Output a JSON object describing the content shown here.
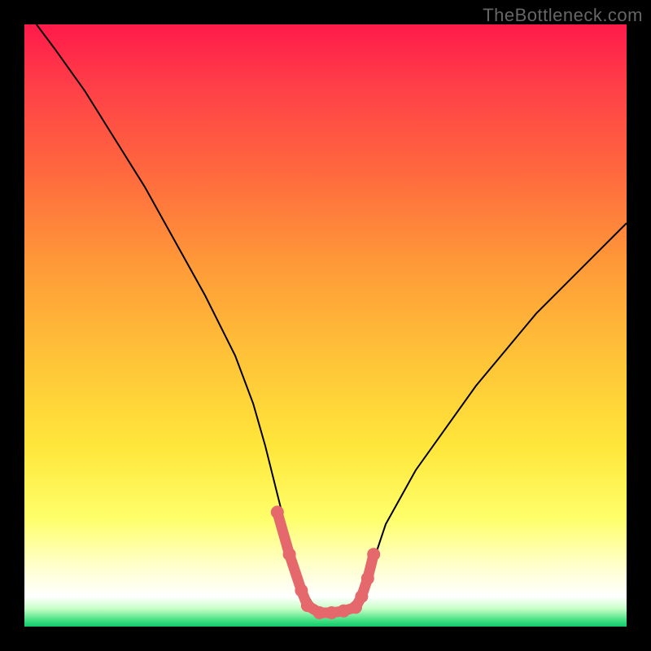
{
  "watermark": "TheBottleneck.com",
  "chart_data": {
    "type": "line",
    "title": "",
    "xlabel": "",
    "ylabel": "",
    "xlim": [
      0,
      100
    ],
    "ylim": [
      0,
      100
    ],
    "x": [
      2,
      5,
      10,
      15,
      20,
      25,
      30,
      35,
      38,
      40,
      42,
      44,
      46,
      48,
      50,
      52,
      54,
      56,
      58,
      60,
      65,
      70,
      75,
      80,
      85,
      90,
      95,
      100
    ],
    "y_curve": [
      100,
      96,
      89,
      81,
      73,
      64,
      55,
      45,
      37,
      30,
      22,
      14,
      7,
      3.5,
      2.3,
      2.3,
      3.2,
      6,
      11,
      17,
      26,
      33,
      40,
      46,
      52,
      57,
      62,
      67
    ],
    "trough_markers": {
      "x": [
        42,
        44,
        46,
        47,
        49,
        51,
        53,
        55,
        56,
        57,
        58
      ],
      "y": [
        19,
        12,
        6,
        3.5,
        2.3,
        2.3,
        2.6,
        3.2,
        5,
        8,
        12
      ]
    },
    "gradient_stops": [
      {
        "pos": 0.0,
        "color": "#ff1a4a"
      },
      {
        "pos": 0.25,
        "color": "#ff6a3e"
      },
      {
        "pos": 0.55,
        "color": "#ffc238"
      },
      {
        "pos": 0.82,
        "color": "#ffff6a"
      },
      {
        "pos": 0.95,
        "color": "#ffffff"
      },
      {
        "pos": 1.0,
        "color": "#10c86a"
      }
    ],
    "curve_color": "#000000",
    "marker_color": "#e4686c"
  }
}
